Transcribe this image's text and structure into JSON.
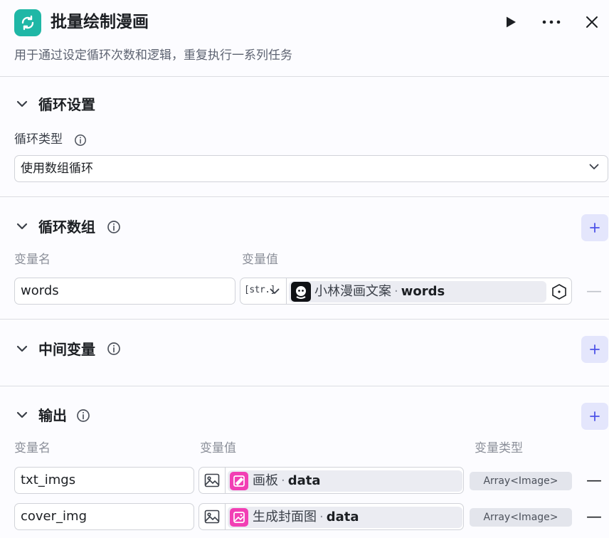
{
  "header": {
    "title": "批量绘制漫画",
    "subtitle": "用于通过设定循环次数和逻辑，重复执行一系列任务"
  },
  "loop_settings": {
    "title": "循环设置",
    "type_label": "循环类型",
    "type_value": "使用数组循环"
  },
  "loop_array": {
    "title": "循环数组",
    "col_name": "变量名",
    "col_value": "变量值",
    "row": {
      "name": "words",
      "type_tag": "[str.]",
      "source_node": "小林漫画文案",
      "source_sep": "·",
      "source_field": "words",
      "remove": "—"
    }
  },
  "intermediate_vars": {
    "title": "中间变量"
  },
  "output": {
    "title": "输出",
    "col_name": "变量名",
    "col_value": "变量值",
    "col_type": "变量类型",
    "rows": [
      {
        "name": "txt_imgs",
        "source_node": "画板",
        "sep": "·",
        "source_field": "data",
        "type": "Array<Image>",
        "remove": "—"
      },
      {
        "name": "cover_img",
        "source_node": "生成封面图",
        "sep": "·",
        "source_field": "data",
        "type": "Array<Image>",
        "remove": "—"
      }
    ]
  },
  "colors": {
    "node_icon_bg": "#1fb7a6",
    "add_button_bg": "#e4e6fc",
    "add_button_fg": "#4d53e8",
    "image_node_icon_bg": "#f23fb4"
  }
}
